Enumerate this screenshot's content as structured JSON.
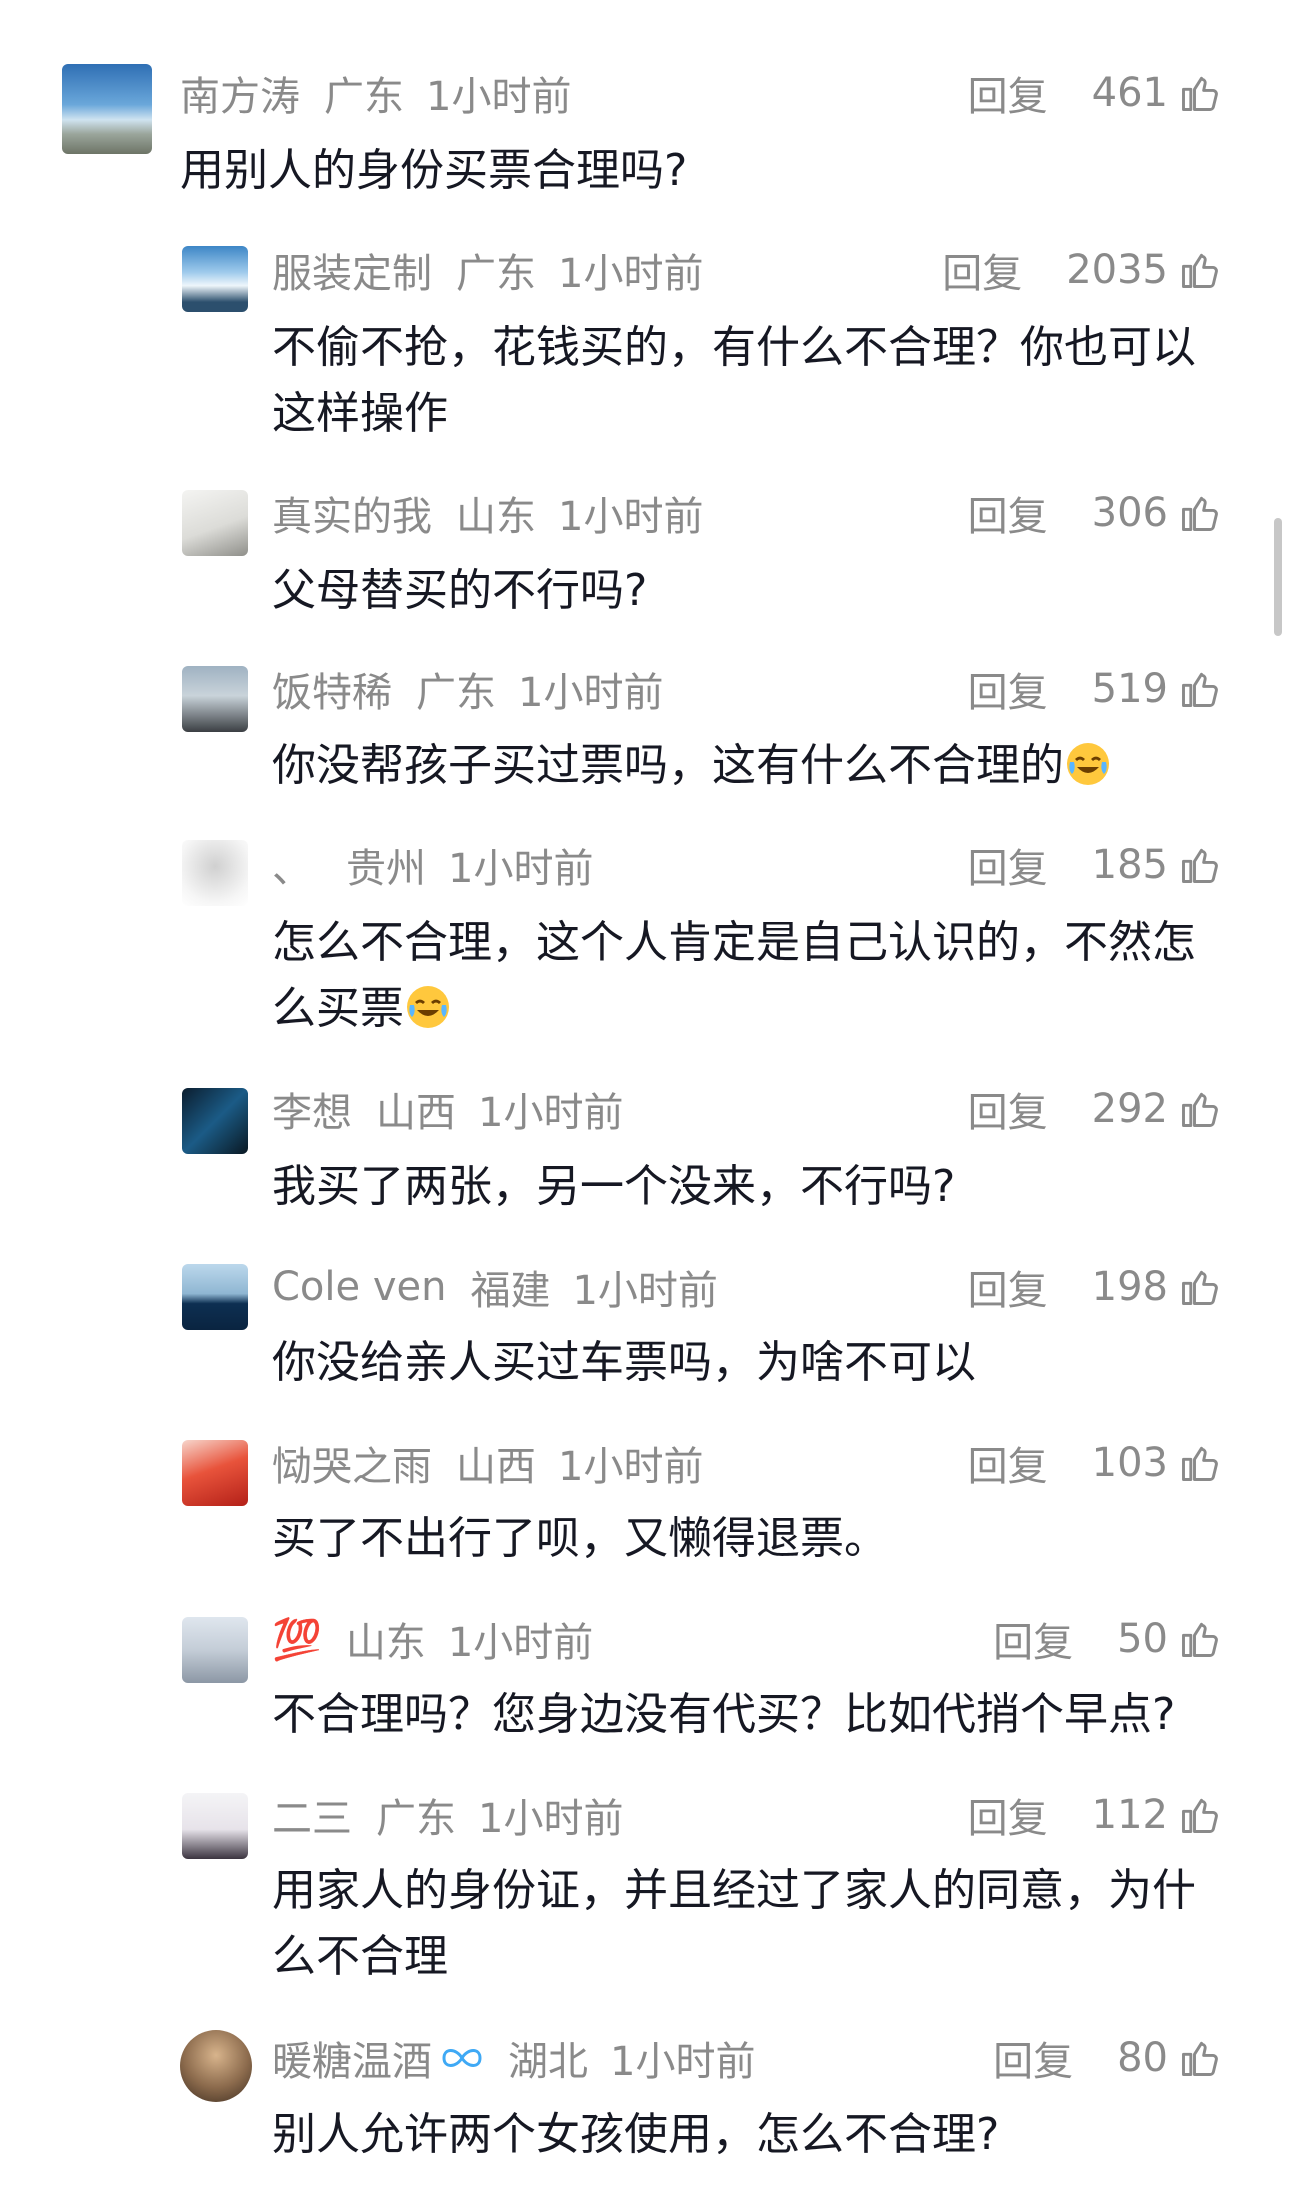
{
  "reply_label": "回复",
  "time_label": "1小时前",
  "comments": [
    {
      "name": "南方涛",
      "location": "广东",
      "likes": "461",
      "text": "用别人的身份买票合理吗?"
    },
    {
      "name": "服装定制",
      "location": "广东",
      "likes": "2035",
      "text": "不偷不抢，花钱买的，有什么不合理？你也可以这样操作"
    },
    {
      "name": "真实的我",
      "location": "山东",
      "likes": "306",
      "text": "父母替买的不行吗?"
    },
    {
      "name": "饭特稀",
      "location": "广东",
      "likes": "519",
      "text": "你没帮孩子买过票吗，这有什么不合理的",
      "emoji": "laugh-cry-emoji"
    },
    {
      "name": "、",
      "location": "贵州",
      "likes": "185",
      "text": "怎么不合理，这个人肯定是自己认识的，不然怎么买票",
      "emoji": "laugh-cry-emoji"
    },
    {
      "name": "李想",
      "location": "山西",
      "likes": "292",
      "text": "我买了两张，另一个没来，不行吗?"
    },
    {
      "name": "Cole ven",
      "location": "福建",
      "likes": "198",
      "text": "你没给亲人买过车票吗，为啥不可以"
    },
    {
      "name": "恸哭之雨",
      "location": "山西",
      "likes": "103",
      "text": "买了不出行了呗，又懒得退票。"
    },
    {
      "name": "💯",
      "location": "山东",
      "likes": "50",
      "text": "不合理吗？您身边没有代买？比如代捎个早点?"
    },
    {
      "name": "二三",
      "location": "广东",
      "likes": "112",
      "text": "用家人的身份证，并且经过了家人的同意，为什么不合理"
    },
    {
      "name": "暖糖温酒",
      "location": "湖北",
      "likes": "80",
      "text": "别人允许两个女孩使用，怎么不合理?",
      "badge": "infinity-badge-icon"
    }
  ],
  "colors": {
    "meta": "#8a8a8a",
    "text": "#161823",
    "badge": "#3fa9f5"
  }
}
